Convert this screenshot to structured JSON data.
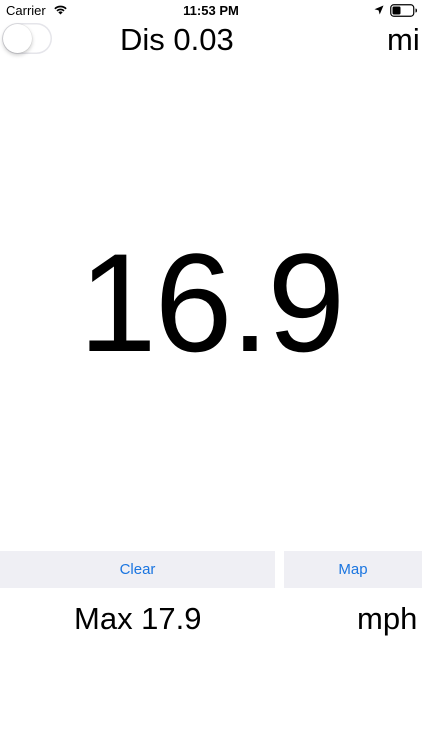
{
  "status_bar": {
    "carrier": "Carrier",
    "time": "11:53 PM",
    "icons": [
      "wifi-icon",
      "location-arrow-icon",
      "battery-icon"
    ]
  },
  "tracking_toggle": {
    "state": "off"
  },
  "distance": {
    "label": "Dis 0.03",
    "unit": "mi"
  },
  "speed": {
    "current": "16.9",
    "max_label": "Max 17.9",
    "unit": "mph"
  },
  "buttons": {
    "clear_label": "Clear",
    "map_label": "Map"
  },
  "colors": {
    "accent": "#1a75e0",
    "button_bg": "#efeff4",
    "text": "#000000",
    "background": "#ffffff"
  }
}
